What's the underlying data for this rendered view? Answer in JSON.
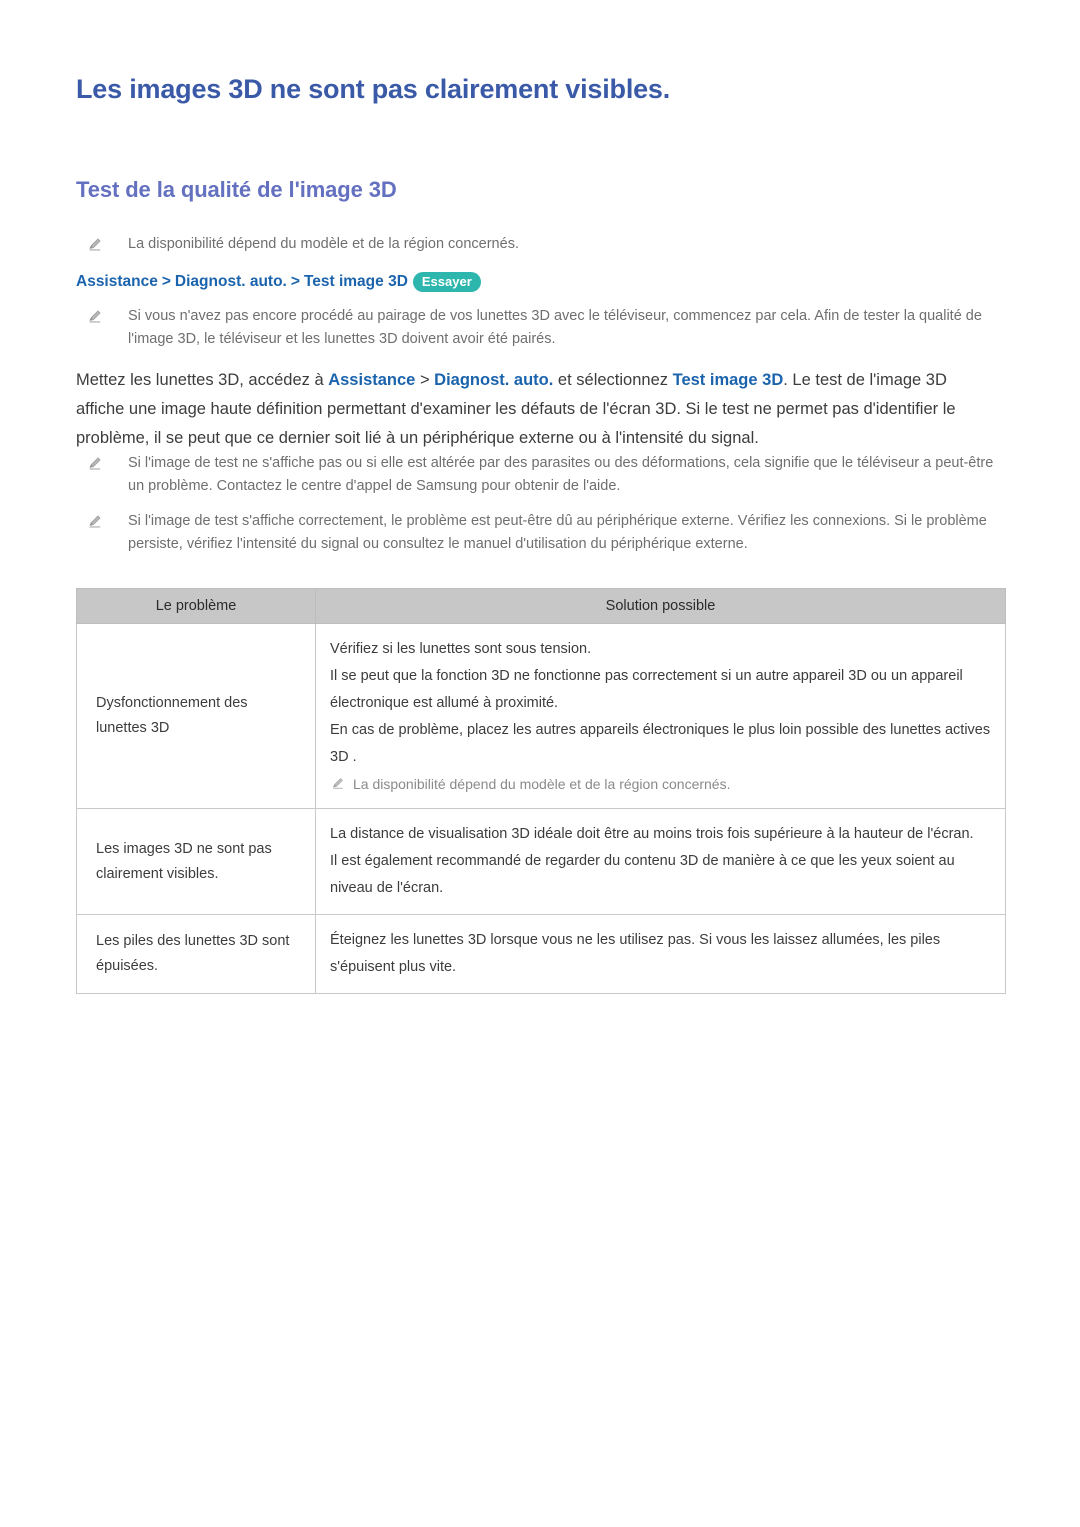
{
  "page": {
    "title": "Les images 3D ne sont pas clairement visibles.",
    "section_title": "Test de la qualité de l'image 3D"
  },
  "notes": [
    {
      "icon": "pencil-icon",
      "text": "La disponibilité dépend du modèle et de la région concernés."
    },
    {
      "icon": "pencil-icon",
      "text": "Si vous n'avez pas encore procédé au pairage de vos lunettes 3D avec le téléviseur, commencez par cela. Afin de tester la qualité de l'image 3D, le téléviseur et les lunettes 3D doivent avoir été pairés."
    },
    {
      "icon": "pencil-icon",
      "text": "Si l'image de test ne s'affiche pas ou si elle est altérée par des parasites ou des déformations, cela signifie que le téléviseur a peut-être un problème. Contactez le centre d'appel de Samsung pour obtenir de l'aide."
    },
    {
      "icon": "pencil-icon",
      "text": "Si l'image de test s'affiche correctement, le problème est peut-être dû au périphérique externe. Vérifiez les connexions. Si le problème persiste, vérifiez l'intensité du signal ou consultez le manuel d'utilisation du périphérique externe."
    }
  ],
  "breadcrumb": {
    "items": [
      "Assistance",
      "Diagnost. auto.",
      "Test image 3D"
    ],
    "separator": ">",
    "badge_label": "Essayer"
  },
  "main_paragraph": {
    "part1": "Mettez les lunettes 3D, accédez à ",
    "link1": "Assistance",
    "sep1": " > ",
    "link2": "Diagnost. auto.",
    "part2": " et sélectionnez ",
    "link3": "Test image 3D",
    "part3": ". Le test de l'image 3D affiche une image haute définition permettant d'examiner les défauts de l'écran 3D. Si le test ne permet pas d'identifier le problème, il se peut que ce dernier soit lié à un périphérique externe ou à l'intensité du signal."
  },
  "table": {
    "headers": [
      "Le problème",
      "Solution possible"
    ],
    "rows": [
      {
        "problem": "Dysfonctionnement des lunettes 3D",
        "solution_lines": [
          "Vérifiez si les lunettes sont sous tension.",
          "Il se peut que la fonction 3D ne fonctionne pas correctement si un autre appareil 3D ou un appareil électronique est allumé à proximité.",
          "En cas de problème, placez les autres appareils électroniques le plus loin possible des lunettes actives 3D ."
        ],
        "note": "La disponibilité dépend du modèle et de la région concernés."
      },
      {
        "problem": "Les images 3D ne sont pas clairement visibles.",
        "solution_lines": [
          "La distance de visualisation 3D idéale doit être au moins trois fois supérieure à la hauteur de l'écran.",
          "Il est également recommandé de regarder du contenu 3D de manière à ce que les yeux soient au niveau de l'écran."
        ],
        "note": ""
      },
      {
        "problem": "Les piles des lunettes 3D sont épuisées.",
        "solution_lines": [
          "Éteignez les lunettes 3D lorsque vous ne les utilisez pas. Si vous les laissez allumées, les piles s'épuisent plus vite."
        ],
        "note": ""
      }
    ]
  },
  "colors": {
    "title": "#3a5aa8",
    "section_title": "#6470c0",
    "link": "#1b64ad",
    "badge_bg": "#2cb6ad",
    "table_header_bg": "#c7c7c7",
    "body_text": "#3c3c3c",
    "note_text": "#6f6f6f"
  }
}
